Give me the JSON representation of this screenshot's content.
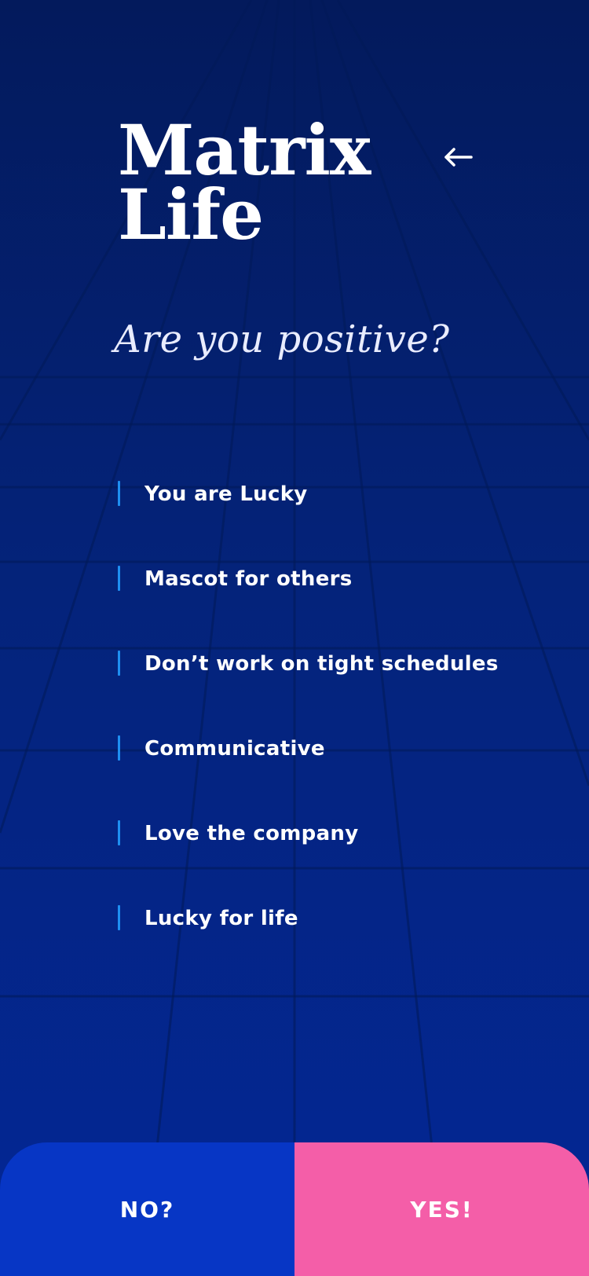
{
  "header": {
    "title_line1": "Matrix",
    "title_line2": "Life",
    "back_icon": "arrow-left-icon"
  },
  "question": "Are you positive?",
  "traits": [
    "You are Lucky",
    "Mascot for others",
    "Don’t work on tight schedules",
    "Communicative",
    "Love the company",
    "Lucky for life"
  ],
  "actions": {
    "no_label": "NO?",
    "yes_label": "YES!"
  },
  "colors": {
    "background_top": "#031a5c",
    "background_bottom": "#032796",
    "accent_bar": "#1e8ff1",
    "no_button": "#0736c5",
    "yes_button": "#f45ea8"
  }
}
